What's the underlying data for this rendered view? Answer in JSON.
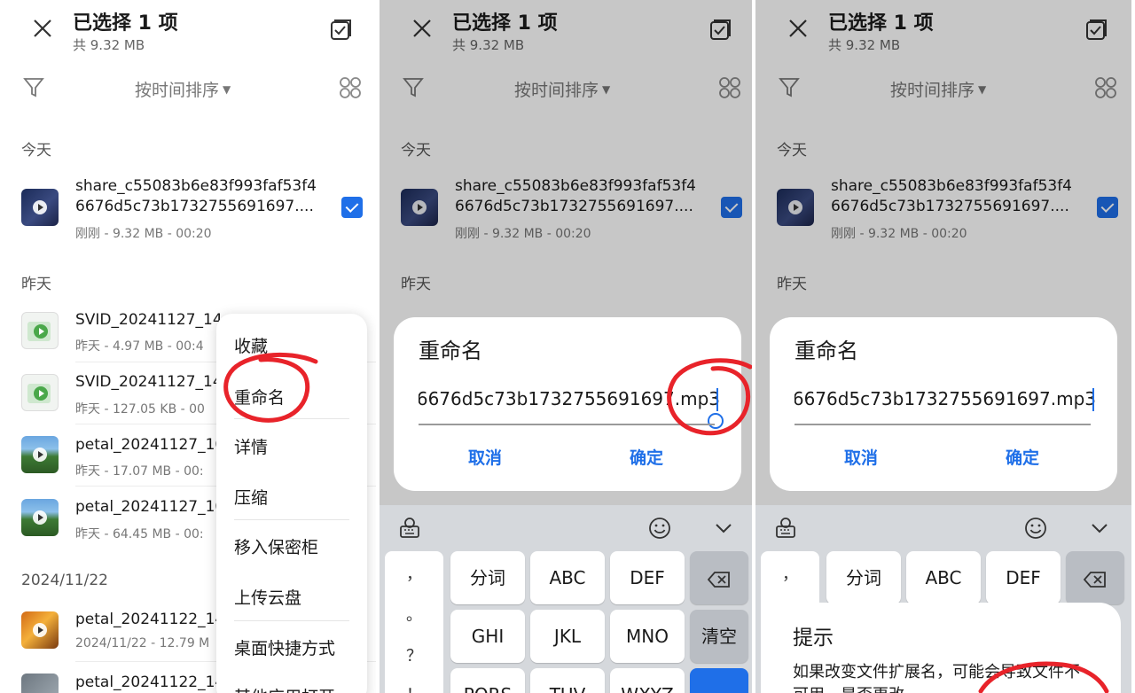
{
  "header": {
    "title": "已选择 1 项",
    "subtitle": "共 9.32 MB"
  },
  "toolbar": {
    "sort_label": "按时间排序"
  },
  "sections": {
    "today": "今天",
    "yesterday": "昨天",
    "date_1122": "2024/11/22"
  },
  "files": [
    {
      "name_line1": "share_c55083b6e83f993faf53f4",
      "name_line2": "6676d5c73b1732755691697....",
      "meta": "刚刚 - 9.32 MB - 00:20",
      "selected": true
    },
    {
      "name": "SVID_20241127_14",
      "meta": "昨天 - 4.97 MB - 00:4"
    },
    {
      "name": "SVID_20241127_14",
      "meta": "昨天 - 127.05 KB - 00"
    },
    {
      "name": "petal_20241127_10",
      "meta": "昨天 - 17.07 MB - 00:"
    },
    {
      "name": "petal_20241127_10",
      "meta": "昨天 - 64.45 MB - 00:"
    },
    {
      "name": "petal_20241122_14",
      "meta": "2024/11/22 - 12.79 M"
    },
    {
      "name": "petal_20241122_14",
      "meta": ""
    }
  ],
  "context_menu": {
    "items": [
      "收藏",
      "重命名",
      "详情",
      "压缩",
      "移入保密柜",
      "上传云盘",
      "桌面快捷方式",
      "其他应用打开"
    ]
  },
  "rename_dialog": {
    "title": "重命名",
    "value_partial": "6676d5c73b1732755691697.mp3",
    "cancel": "取消",
    "confirm": "确定"
  },
  "keyboard": {
    "punct": [
      "，",
      "。",
      "？",
      "！"
    ],
    "row1": [
      "分词",
      "ABC",
      "DEF"
    ],
    "row2": [
      "GHI",
      "JKL",
      "MNO"
    ],
    "row3": [
      "PQRS",
      "TUV",
      "WXYZ"
    ],
    "clear": "清空"
  },
  "hint_dialog": {
    "title": "提示",
    "body": "如果改变文件扩展名，可能会导致文件不可用，是否更改"
  },
  "colors": {
    "accent": "#1f6fe8",
    "annotation": "#e8232a"
  }
}
